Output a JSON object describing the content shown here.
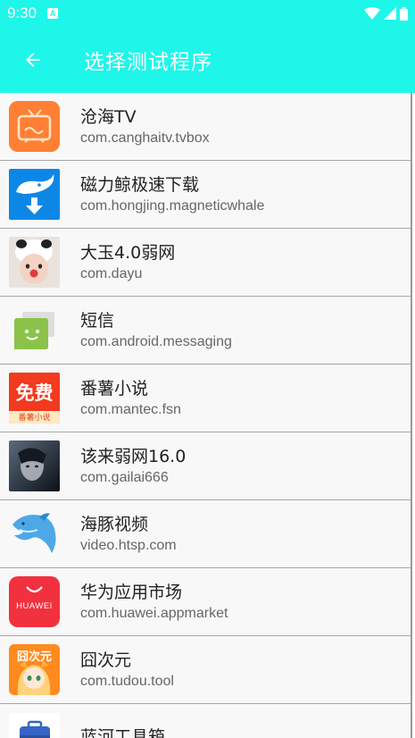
{
  "status_bar": {
    "time": "9:30",
    "notification_badge": "A"
  },
  "app_bar": {
    "title": "选择测试程序",
    "back_icon": "arrow-left-icon"
  },
  "colors": {
    "accent": "#1ef6ea"
  },
  "apps": [
    {
      "name": "沧海TV",
      "package": "com.canghaitv.tvbox",
      "icon": "tv-icon"
    },
    {
      "name": "磁力鲸极速下载",
      "package": "com.hongjing.magneticwhale",
      "icon": "whale-download-icon"
    },
    {
      "name": "大玉4.0弱网",
      "package": "com.dayu",
      "icon": "panda-hat-child-icon"
    },
    {
      "name": "短信",
      "package": "com.android.messaging",
      "icon": "message-bubble-icon"
    },
    {
      "name": "番薯小说",
      "package": "com.mantec.fsn",
      "icon": "free-novel-icon",
      "icon_text": "免费",
      "icon_subtext": "番薯小说"
    },
    {
      "name": "该来弱网16.0",
      "package": "com.gailai666",
      "icon": "portrait-icon"
    },
    {
      "name": "海豚视频",
      "package": "video.htsp.com",
      "icon": "dolphin-icon"
    },
    {
      "name": "华为应用市场",
      "package": "com.huawei.appmarket",
      "icon": "huawei-bag-icon",
      "icon_text": "HUAWEI"
    },
    {
      "name": "囧次元",
      "package": "com.tudou.tool",
      "icon": "anime-girl-icon",
      "icon_text": "囧次元"
    },
    {
      "name": "蓝河工具箱",
      "package": "",
      "icon": "toolbox-icon"
    }
  ]
}
